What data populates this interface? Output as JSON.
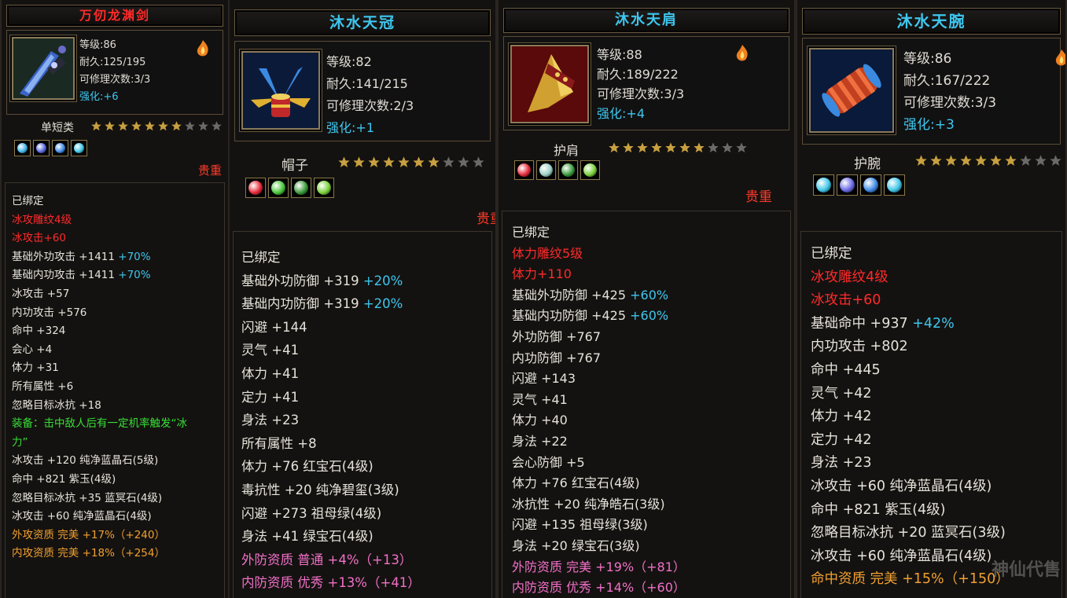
{
  "panels": [
    {
      "title": "万仞龙渊剑",
      "title_color": "#ff2a2a",
      "icon": "sword-icon",
      "level": "等级:86",
      "durability": "耐久:125/195",
      "repair": "可修理次数:3/3",
      "enhance_label": "强化:",
      "enhance_value": "+6",
      "category": "单短类",
      "stars_filled": 7,
      "stars_total": 10,
      "gems": [
        "#3fb4e6",
        "#5a6ae0",
        "#3f8ae6",
        "#3fc6e6"
      ],
      "quality": "贵重",
      "lines": [
        {
          "text": "已绑定",
          "color": "white"
        },
        {
          "text": "冰攻雕纹4级",
          "color": "red"
        },
        {
          "text": "冰攻击+60",
          "color": "red"
        },
        {
          "text": "基础外功攻击 +1411 ",
          "suffix": "+70%",
          "color": "white"
        },
        {
          "text": "基础内功攻击 +1411 ",
          "suffix": "+70%",
          "color": "white"
        },
        {
          "text": "冰攻击 +57",
          "color": "white"
        },
        {
          "text": "内功攻击 +576",
          "color": "white"
        },
        {
          "text": "命中 +324",
          "color": "white"
        },
        {
          "text": "会心 +4",
          "color": "white"
        },
        {
          "text": "体力 +31",
          "color": "white"
        },
        {
          "text": "所有属性 +6",
          "color": "white"
        },
        {
          "text": "忽略目标冰抗 +18",
          "color": "white"
        },
        {
          "text": "装备：击中敌人后有一定机率触发“冰",
          "color": "green"
        },
        {
          "text": "力”",
          "color": "green"
        },
        {
          "text": "冰攻击 +120 纯净蓝晶石(5级)",
          "color": "white"
        },
        {
          "text": "命中 +821 紫玉(4级)",
          "color": "white"
        },
        {
          "text": "忽略目标冰抗 +35 蓝冥石(4级)",
          "color": "white"
        },
        {
          "text": "冰攻击 +60 纯净蓝晶石(4级)",
          "color": "white"
        },
        {
          "text": "外攻资质   完美 +17%（+240）",
          "color": "orange"
        },
        {
          "text": "内攻资质   完美 +18%（+254）",
          "color": "orange"
        }
      ]
    },
    {
      "title": "沐水天冠",
      "title_color": "#3ec6ee",
      "icon": "crown-icon",
      "level": "等级:82",
      "durability": "耐久:141/215",
      "repair": "可修理次数:2/3",
      "enhance_label": "强化:",
      "enhance_value": "+1",
      "category": "帽子",
      "stars_filled": 7,
      "stars_total": 10,
      "gems": [
        "#e62a3a",
        "#4ac63a",
        "#3a9a3a",
        "#7ad03a"
      ],
      "quality": "贵重",
      "lines": [
        {
          "text": "已绑定",
          "color": "white"
        },
        {
          "text": "基础外功防御 +319 ",
          "suffix": "+20%",
          "color": "white"
        },
        {
          "text": "基础内功防御 +319 ",
          "suffix": "+20%",
          "color": "white"
        },
        {
          "text": "闪避 +144",
          "color": "white"
        },
        {
          "text": "灵气 +41",
          "color": "white"
        },
        {
          "text": "体力 +41",
          "color": "white"
        },
        {
          "text": "定力 +41",
          "color": "white"
        },
        {
          "text": "身法 +23",
          "color": "white"
        },
        {
          "text": "所有属性 +8",
          "color": "white"
        },
        {
          "text": "体力 +76 红宝石(4级)",
          "color": "white"
        },
        {
          "text": "毒抗性 +20 纯净碧玺(3级)",
          "color": "white"
        },
        {
          "text": "闪避 +273 祖母绿(4级)",
          "color": "white"
        },
        {
          "text": "身法 +41 绿宝石(4级)",
          "color": "white"
        },
        {
          "text": "外防资质   普通 +4%（+13）",
          "color": "pink"
        },
        {
          "text": "内防资质   优秀 +13%（+41）",
          "color": "pink"
        }
      ]
    },
    {
      "title": "沐水天肩",
      "title_color": "#3ec6ee",
      "icon": "shoulder-icon",
      "level": "等级:88",
      "durability": "耐久:189/222",
      "repair": "可修理次数:3/3",
      "enhance_label": "强化:",
      "enhance_value": "+4",
      "category": "护肩",
      "stars_filled": 7,
      "stars_total": 10,
      "gems": [
        "#e62a3a",
        "#9ad0c6",
        "#3a9a3a",
        "#7ad03a"
      ],
      "quality": "贵重",
      "lines": [
        {
          "text": "已绑定",
          "color": "white"
        },
        {
          "text": "体力雕纹5级",
          "color": "red"
        },
        {
          "text": "体力+110",
          "color": "red"
        },
        {
          "text": "基础外功防御 +425 ",
          "suffix": "+60%",
          "color": "white"
        },
        {
          "text": "基础内功防御 +425 ",
          "suffix": "+60%",
          "color": "white"
        },
        {
          "text": "外功防御 +767",
          "color": "white"
        },
        {
          "text": "内功防御 +767",
          "color": "white"
        },
        {
          "text": "闪避 +143",
          "color": "white"
        },
        {
          "text": "灵气 +41",
          "color": "white"
        },
        {
          "text": "体力 +40",
          "color": "white"
        },
        {
          "text": "身法 +22",
          "color": "white"
        },
        {
          "text": "会心防御 +5",
          "color": "white"
        },
        {
          "text": "体力 +76 红宝石(4级)",
          "color": "white"
        },
        {
          "text": "冰抗性 +20 纯净皓石(3级)",
          "color": "white"
        },
        {
          "text": "闪避 +135 祖母绿(3级)",
          "color": "white"
        },
        {
          "text": "身法 +20 绿宝石(3级)",
          "color": "white"
        },
        {
          "text": "外防资质   完美 +19%（+81）",
          "color": "pink"
        },
        {
          "text": "内防资质   优秀 +14%（+60）",
          "color": "pink"
        }
      ]
    },
    {
      "title": "沐水天腕",
      "title_color": "#3ec6ee",
      "icon": "bracer-icon",
      "level": "等级:86",
      "durability": "耐久:167/222",
      "repair": "可修理次数:3/3",
      "enhance_label": "强化:",
      "enhance_value": "+3",
      "category": "护腕",
      "stars_filled": 7,
      "stars_total": 10,
      "gems": [
        "#3fc6e6",
        "#6a6ae6",
        "#3f8ae6",
        "#3fc6e6"
      ],
      "quality": "",
      "lines": [
        {
          "text": "已绑定",
          "color": "white"
        },
        {
          "text": "冰攻雕纹4级",
          "color": "red"
        },
        {
          "text": "冰攻击+60",
          "color": "red"
        },
        {
          "text": "基础命中 +937 ",
          "suffix": "+42%",
          "color": "white"
        },
        {
          "text": "内功攻击 +802",
          "color": "white"
        },
        {
          "text": "命中 +445",
          "color": "white"
        },
        {
          "text": "灵气 +42",
          "color": "white"
        },
        {
          "text": "体力 +42",
          "color": "white"
        },
        {
          "text": "定力 +42",
          "color": "white"
        },
        {
          "text": "身法 +23",
          "color": "white"
        },
        {
          "text": "冰攻击 +60 纯净蓝晶石(4级)",
          "color": "white"
        },
        {
          "text": "命中 +821 紫玉(4级)",
          "color": "white"
        },
        {
          "text": "忽略目标冰抗 +20 蓝冥石(3级)",
          "color": "white"
        },
        {
          "text": "冰攻击 +60 纯净蓝晶石(4级)",
          "color": "white"
        },
        {
          "text": "命中资质   完美 +15%（+150）",
          "color": "orange"
        }
      ]
    }
  ],
  "watermark": "神仙代售"
}
